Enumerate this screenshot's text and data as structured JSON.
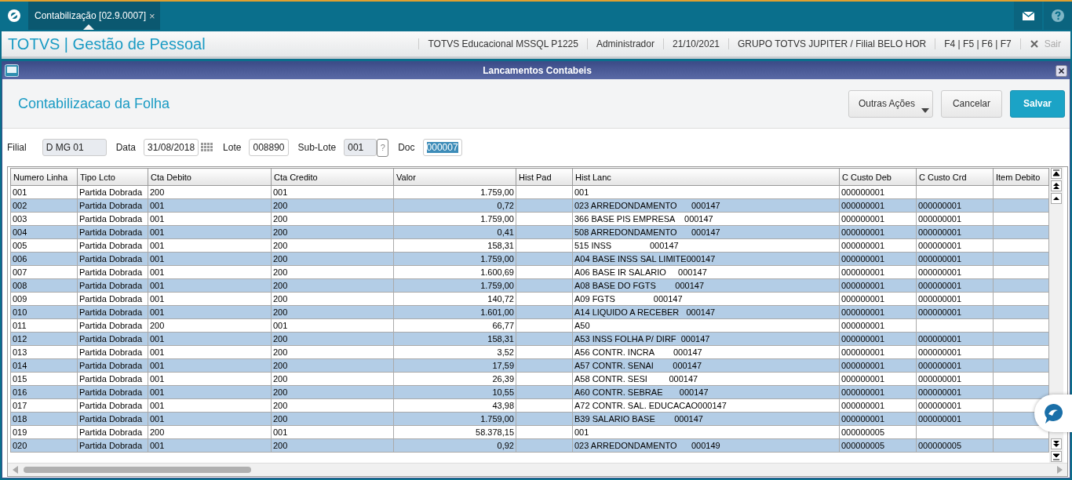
{
  "top_bar": {
    "tab": {
      "label": "Contabilização [02.9.0007]",
      "close": "×",
      "selected": true
    }
  },
  "header": {
    "title": "TOTVS | Gestão de Pessoal",
    "info": [
      "TOTVS Educacional MSSQL P1225",
      "Administrador",
      "21/10/2021",
      "GRUPO TOTVS JUPITER / Filial BELO HOR",
      "F4 | F5 | F6 | F7"
    ],
    "exit": "Sair"
  },
  "dialog": {
    "title": "Lancamentos Contabeis",
    "heading": "Contabilizacao da Folha",
    "buttons": [
      {
        "label": "Outras Ações",
        "kind": "menu"
      },
      {
        "label": "Cancelar",
        "kind": "secondary"
      },
      {
        "label": "Salvar",
        "kind": "primary"
      }
    ]
  },
  "form": {
    "fields": [
      {
        "label": "Filial",
        "value": "D MG 01",
        "kind": "readonly"
      },
      {
        "label": "Data",
        "value": "31/08/2018",
        "kind": "date"
      },
      {
        "label": "Lote",
        "value": "008890",
        "kind": "text"
      },
      {
        "label": "Sub-Lote",
        "value": "001",
        "kind": "lookup",
        "lookup": "?"
      },
      {
        "label": "Doc",
        "value": "000007",
        "kind": "highlighted"
      }
    ]
  },
  "table": {
    "columns": [
      "Numero Linha",
      "Tipo Lcto",
      "Cta Debito",
      "Cta Credito",
      "Valor",
      "Hist Pad",
      "Hist Lanc",
      "C Custo Deb",
      "C Custo Crd",
      "Item Debito"
    ],
    "rows": [
      {
        "numero": "001",
        "tipo": "Partida Dobrada",
        "debito": "200",
        "credito": "001",
        "valor": "1.759,00",
        "hist_lanc": "001",
        "cc_deb": "000000001"
      },
      {
        "numero": "002",
        "tipo": "Partida Dobrada",
        "debito": "001",
        "credito": "200",
        "valor": "0,72",
        "hist_lanc": "023 ARREDONDAMENTO      000147",
        "cc_deb": "000000001",
        "cc_crd": "000000001"
      },
      {
        "numero": "003",
        "tipo": "Partida Dobrada",
        "debito": "001",
        "credito": "200",
        "valor": "1.759,00",
        "hist_lanc": "366 BASE PIS EMPRESA    000147",
        "cc_deb": "000000001",
        "cc_crd": "000000001"
      },
      {
        "numero": "004",
        "tipo": "Partida Dobrada",
        "debito": "001",
        "credito": "200",
        "valor": "0,41",
        "hist_lanc": "508 ARREDONDAMENTO      000147",
        "cc_deb": "000000001",
        "cc_crd": "000000001"
      },
      {
        "numero": "005",
        "tipo": "Partida Dobrada",
        "debito": "001",
        "credito": "200",
        "valor": "158,31",
        "hist_lanc": "515 INSS                000147",
        "cc_deb": "000000001",
        "cc_crd": "000000001"
      },
      {
        "numero": "006",
        "tipo": "Partida Dobrada",
        "debito": "001",
        "credito": "200",
        "valor": "1.759,00",
        "hist_lanc": "A04 BASE INSS SAL LIMITE000147",
        "cc_deb": "000000001",
        "cc_crd": "000000001"
      },
      {
        "numero": "007",
        "tipo": "Partida Dobrada",
        "debito": "001",
        "credito": "200",
        "valor": "1.600,69",
        "hist_lanc": "A06 BASE IR SALARIO     000147",
        "cc_deb": "000000001",
        "cc_crd": "000000001"
      },
      {
        "numero": "008",
        "tipo": "Partida Dobrada",
        "debito": "001",
        "credito": "200",
        "valor": "1.759,00",
        "hist_lanc": "A08 BASE DO FGTS        000147",
        "cc_deb": "000000001",
        "cc_crd": "000000001"
      },
      {
        "numero": "009",
        "tipo": "Partida Dobrada",
        "debito": "001",
        "credito": "200",
        "valor": "140,72",
        "hist_lanc": "A09 FGTS                000147",
        "cc_deb": "000000001",
        "cc_crd": "000000001"
      },
      {
        "numero": "010",
        "tipo": "Partida Dobrada",
        "debito": "001",
        "credito": "200",
        "valor": "1.601,00",
        "hist_lanc": "A14 LIQUIDO A RECEBER   000147",
        "cc_deb": "000000001",
        "cc_crd": "000000001"
      },
      {
        "numero": "011",
        "tipo": "Partida Dobrada",
        "debito": "200",
        "credito": "001",
        "valor": "66,77",
        "hist_lanc": "A50",
        "cc_deb": "000000001"
      },
      {
        "numero": "012",
        "tipo": "Partida Dobrada",
        "debito": "001",
        "credito": "200",
        "valor": "158,31",
        "hist_lanc": "A53 INSS FOLHA P/ DIRF  000147",
        "cc_deb": "000000001",
        "cc_crd": "000000001"
      },
      {
        "numero": "013",
        "tipo": "Partida Dobrada",
        "debito": "001",
        "credito": "200",
        "valor": "3,52",
        "hist_lanc": "A56 CONTR. INCRA        000147",
        "cc_deb": "000000001",
        "cc_crd": "000000001"
      },
      {
        "numero": "014",
        "tipo": "Partida Dobrada",
        "debito": "001",
        "credito": "200",
        "valor": "17,59",
        "hist_lanc": "A57 CONTR. SENAI        000147",
        "cc_deb": "000000001",
        "cc_crd": "000000001"
      },
      {
        "numero": "015",
        "tipo": "Partida Dobrada",
        "debito": "001",
        "credito": "200",
        "valor": "26,39",
        "hist_lanc": "A58 CONTR. SESI         000147",
        "cc_deb": "000000001",
        "cc_crd": "000000001"
      },
      {
        "numero": "016",
        "tipo": "Partida Dobrada",
        "debito": "001",
        "credito": "200",
        "valor": "10,55",
        "hist_lanc": "A60 CONTR. SEBRAE       000147",
        "cc_deb": "000000001",
        "cc_crd": "000000001"
      },
      {
        "numero": "017",
        "tipo": "Partida Dobrada",
        "debito": "001",
        "credito": "200",
        "valor": "43,98",
        "hist_lanc": "A72 CONTR. SAL. EDUCACAO000147",
        "cc_deb": "000000001",
        "cc_crd": "000000001"
      },
      {
        "numero": "018",
        "tipo": "Partida Dobrada",
        "debito": "001",
        "credito": "200",
        "valor": "1.759,00",
        "hist_lanc": "B39 SALARIO BASE        000147",
        "cc_deb": "000000001",
        "cc_crd": "000000001"
      },
      {
        "numero": "019",
        "tipo": "Partida Dobrada",
        "debito": "200",
        "credito": "001",
        "valor": "58.378,15",
        "hist_lanc": "001",
        "cc_deb": "000000005"
      },
      {
        "numero": "020",
        "tipo": "Partida Dobrada",
        "debito": "001",
        "credito": "200",
        "valor": "0,92",
        "hist_lanc": "023 ARREDONDAMENTO      000149",
        "cc_deb": "000000005",
        "cc_crd": "000000005"
      }
    ]
  }
}
